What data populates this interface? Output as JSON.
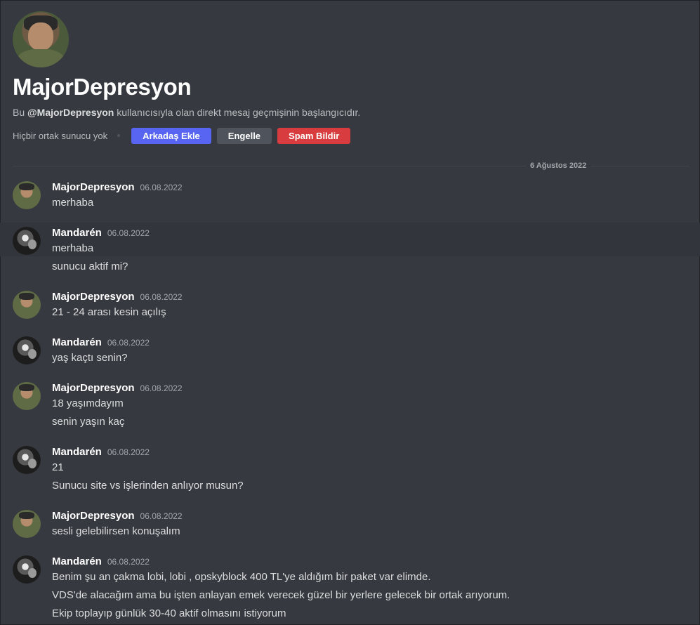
{
  "header": {
    "name": "MajorDepresyon",
    "intro_prefix": "Bu ",
    "intro_user": "@MajorDepresyon",
    "intro_suffix": " kullanıcısıyla olan direkt mesaj geçmişinin başlangıcıdır.",
    "no_server": "Hiçbir ortak sunucu yok",
    "buttons": {
      "add_friend": "Arkadaş Ekle",
      "block": "Engelle",
      "report_spam": "Spam Bildir"
    }
  },
  "date_divider": "6 Ağustos 2022",
  "messages": [
    {
      "author": "MajorDepresyon",
      "time": "06.08.2022",
      "lines": [
        "merhaba"
      ]
    },
    {
      "author": "Mandarén",
      "time": "06.08.2022",
      "lines": [
        "merhaba",
        "sunucu aktif mi?"
      ]
    },
    {
      "author": "MajorDepresyon",
      "time": "06.08.2022",
      "lines": [
        "21 - 24 arası kesin açılış"
      ]
    },
    {
      "author": "Mandarén",
      "time": "06.08.2022",
      "lines": [
        "yaş kaçtı senin?"
      ]
    },
    {
      "author": "MajorDepresyon",
      "time": "06.08.2022",
      "lines": [
        "18  yaşımdayım",
        "senin yaşın kaç"
      ]
    },
    {
      "author": "Mandarén",
      "time": "06.08.2022",
      "lines": [
        "21",
        "Sunucu site vs işlerinden anlıyor musun?"
      ]
    },
    {
      "author": "MajorDepresyon",
      "time": "06.08.2022",
      "lines": [
        "sesli gelebilirsen konuşalım"
      ]
    },
    {
      "author": "Mandarén",
      "time": "06.08.2022",
      "lines": [
        "Benim şu an çakma lobi, lobi , opskyblock 400 TL'ye aldığım bir paket var elimde.",
        "VDS'de alacağım ama bu işten anlayan emek verecek güzel bir yerlere gelecek bir ortak arıyorum.",
        "Ekip toplayıp günlük 30-40 aktif olmasını istiyorum"
      ]
    }
  ]
}
